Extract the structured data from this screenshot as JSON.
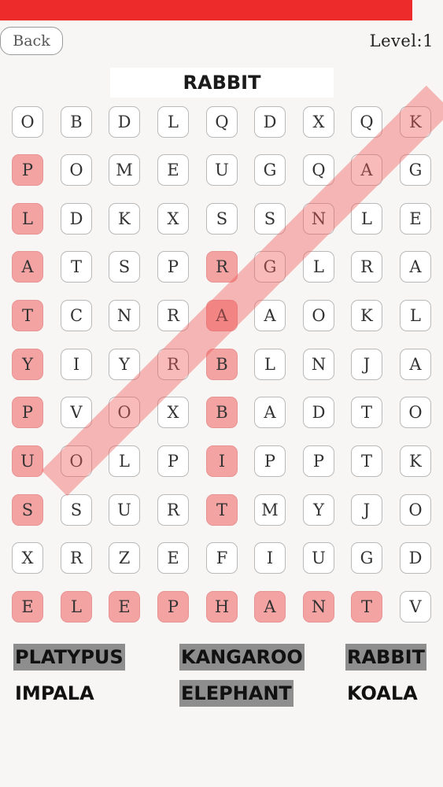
{
  "header": {
    "back_label": "Back",
    "level_label": "Level",
    "level_sep": ":",
    "level_value": "1"
  },
  "current_word": "RABBIT",
  "grid": [
    [
      "O",
      "B",
      "D",
      "L",
      "Q",
      "D",
      "X",
      "Q",
      "K"
    ],
    [
      "P",
      "O",
      "M",
      "E",
      "U",
      "G",
      "Q",
      "A",
      "G"
    ],
    [
      "L",
      "D",
      "K",
      "X",
      "S",
      "S",
      "N",
      "L",
      "E"
    ],
    [
      "A",
      "T",
      "S",
      "P",
      "R",
      "G",
      "L",
      "R",
      "A"
    ],
    [
      "T",
      "C",
      "N",
      "R",
      "A",
      "A",
      "O",
      "K",
      "L"
    ],
    [
      "Y",
      "I",
      "Y",
      "R",
      "B",
      "L",
      "N",
      "J",
      "A"
    ],
    [
      "P",
      "V",
      "O",
      "X",
      "B",
      "A",
      "D",
      "T",
      "O"
    ],
    [
      "U",
      "O",
      "L",
      "P",
      "I",
      "P",
      "P",
      "T",
      "K"
    ],
    [
      "S",
      "S",
      "U",
      "R",
      "T",
      "M",
      "Y",
      "J",
      "O"
    ],
    [
      "X",
      "R",
      "Z",
      "E",
      "F",
      "I",
      "U",
      "G",
      "D"
    ],
    [
      "E",
      "L",
      "E",
      "P",
      "H",
      "A",
      "N",
      "T",
      "V"
    ]
  ],
  "words": [
    {
      "text": "PLATYPUS",
      "found": true
    },
    {
      "text": "KANGAROO",
      "found": true
    },
    {
      "text": "RABBIT",
      "found": true
    },
    {
      "text": "IMPALA",
      "found": false
    },
    {
      "text": "ELEPHANT",
      "found": true
    },
    {
      "text": "KOALA",
      "found": false
    }
  ],
  "colors": {
    "progress": "#ee2b2b",
    "found_cell": "#f4a3a3",
    "found_word_bg": "#8e8e8e"
  }
}
